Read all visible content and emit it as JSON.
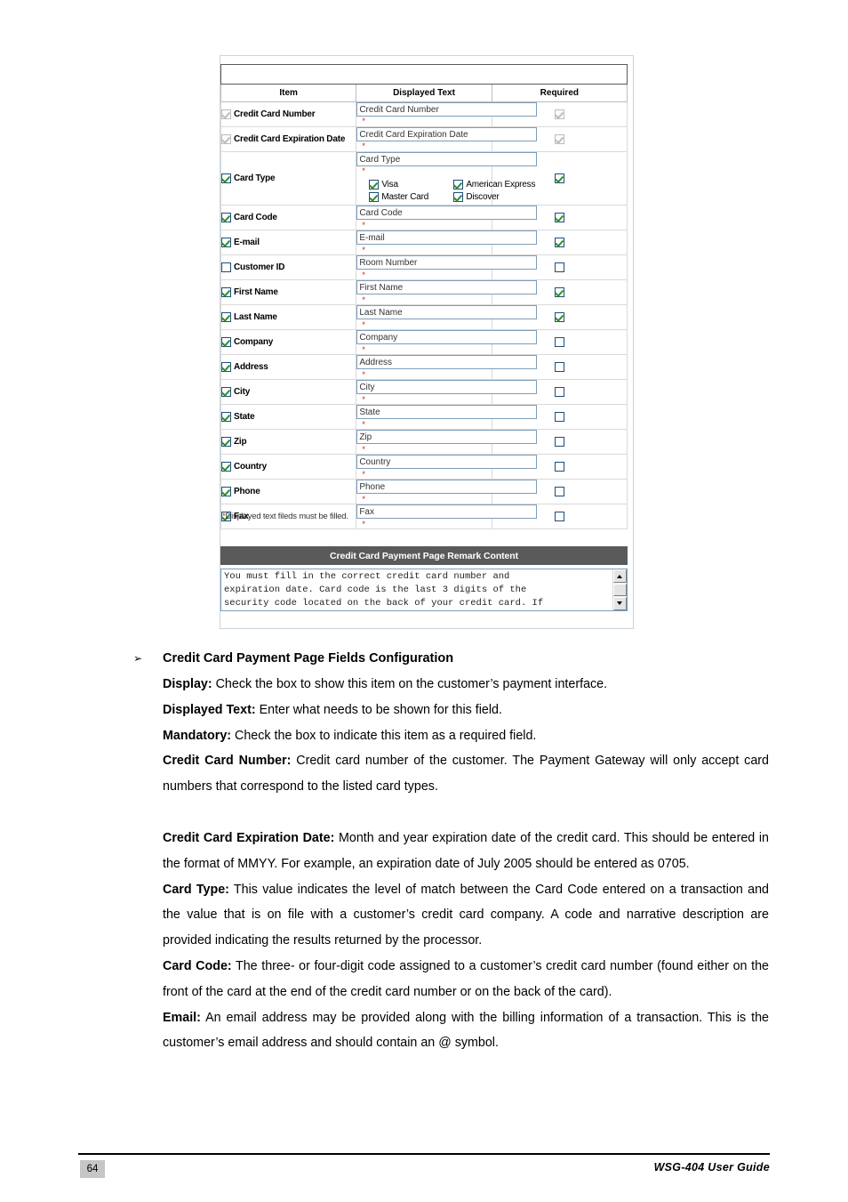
{
  "screenshot": {
    "fields_panel": {
      "title": "Credit Card Payment Page Fields Configuration",
      "columns": {
        "item": "Item",
        "displayed_text": "Displayed Text",
        "required": "Required"
      },
      "rows": [
        {
          "label": "Credit Card Number",
          "item_checked": true,
          "item_disabled": true,
          "text": "Credit Card Number",
          "star": "*",
          "required_checked": true,
          "required_disabled": true
        },
        {
          "label": "Credit Card Expiration Date",
          "item_checked": true,
          "item_disabled": true,
          "text": "Credit Card Expiration Date",
          "star": "*",
          "required_checked": true,
          "required_disabled": true
        },
        {
          "label": "Card Type",
          "item_checked": true,
          "item_disabled": false,
          "text": "Card Type",
          "star": "*",
          "required_checked": true,
          "required_disabled": false,
          "card_types": [
            {
              "label": "Visa",
              "checked": true
            },
            {
              "label": "American Express",
              "checked": true
            },
            {
              "label": "Master Card",
              "checked": true
            },
            {
              "label": "Discover",
              "checked": true
            }
          ]
        },
        {
          "label": "Card Code",
          "item_checked": true,
          "item_disabled": false,
          "text": "Card Code",
          "star": "*",
          "required_checked": true,
          "required_disabled": false
        },
        {
          "label": "E-mail",
          "item_checked": true,
          "item_disabled": false,
          "text": "E-mail",
          "star": "*",
          "required_checked": true,
          "required_disabled": false
        },
        {
          "label": "Customer ID",
          "item_checked": false,
          "item_disabled": false,
          "text": "Room Number",
          "star": "*",
          "required_checked": false,
          "required_disabled": false
        },
        {
          "label": "First Name",
          "item_checked": true,
          "item_disabled": false,
          "text": "First Name",
          "star": "*",
          "required_checked": true,
          "required_disabled": false
        },
        {
          "label": "Last Name",
          "item_checked": true,
          "item_disabled": false,
          "text": "Last Name",
          "star": "*",
          "required_checked": true,
          "required_disabled": false
        },
        {
          "label": "Company",
          "item_checked": true,
          "item_disabled": false,
          "text": "Company",
          "star": "*",
          "required_checked": false,
          "required_disabled": false
        },
        {
          "label": "Address",
          "item_checked": true,
          "item_disabled": false,
          "text": "Address",
          "star": "*",
          "required_checked": false,
          "required_disabled": false
        },
        {
          "label": "City",
          "item_checked": true,
          "item_disabled": false,
          "text": "City",
          "star": "*",
          "required_checked": false,
          "required_disabled": false
        },
        {
          "label": "State",
          "item_checked": true,
          "item_disabled": false,
          "text": "State",
          "star": "*",
          "required_checked": false,
          "required_disabled": false
        },
        {
          "label": "Zip",
          "item_checked": true,
          "item_disabled": false,
          "text": "Zip",
          "star": "*",
          "required_checked": false,
          "required_disabled": false
        },
        {
          "label": "Country",
          "item_checked": true,
          "item_disabled": false,
          "text": "Country",
          "star": "*",
          "required_checked": false,
          "required_disabled": false
        },
        {
          "label": "Phone",
          "item_checked": true,
          "item_disabled": false,
          "text": "Phone",
          "star": "*",
          "required_checked": false,
          "required_disabled": false
        },
        {
          "label": "Fax",
          "item_checked": true,
          "item_disabled": false,
          "text": "Fax",
          "star": "*",
          "required_checked": false,
          "required_disabled": false
        }
      ],
      "footnote_star": "*",
      "footnote": "Displayed text fileds must be filled."
    },
    "remark_panel": {
      "title": "Credit Card Payment Page Remark Content",
      "content": "You must fill in the correct credit card number and\nexpiration date. Card code is the last 3 digits of the\nsecurity code located on the back of your credit card. If",
      "scrollbar": {
        "up": "scroll-up-arrow",
        "down": "scroll-down-arrow"
      }
    }
  },
  "doc": {
    "heading": "Credit Card Payment Page Fields Configuration",
    "heading_bullet": "➢",
    "paragraphs": [
      {
        "term": "Display:",
        "text": " Check the box to show this item on the customer’s payment interface."
      },
      {
        "term": "Displayed Text:",
        "text": " Enter what needs to be shown for this field."
      },
      {
        "term": "Mandatory:",
        "text": " Check the box to indicate this item as a required field."
      },
      {
        "term": "Credit Card Number:",
        "text": " Credit card number of the customer. The Payment Gateway will only accept card numbers that correspond to the listed card types."
      },
      {
        "term": "Credit Card Expiration Date:",
        "text": " Month and year expiration date of the credit card. This should be entered in the format of MMYY. For example, an expiration date of July 2005 should be entered as 0705."
      },
      {
        "term": "Card Type:",
        "text": " This value indicates the level of match between the Card Code entered on a transaction and the value that is on file with a customer’s credit card company. A code and narrative description are provided indicating the results returned by the processor."
      },
      {
        "term": "Card Code:",
        "text": " The three- or four-digit code assigned to a customer’s credit card number (found either on the front of the card at the end of the credit card number or on the back of the card)."
      },
      {
        "term": "Email:",
        "text": " An email address may be provided along with the billing information of a transaction. This is the customer’s email address and should contain an @ symbol."
      }
    ]
  },
  "footer": {
    "page_number": "64",
    "guide_name": "WSG-404 User Guide"
  }
}
